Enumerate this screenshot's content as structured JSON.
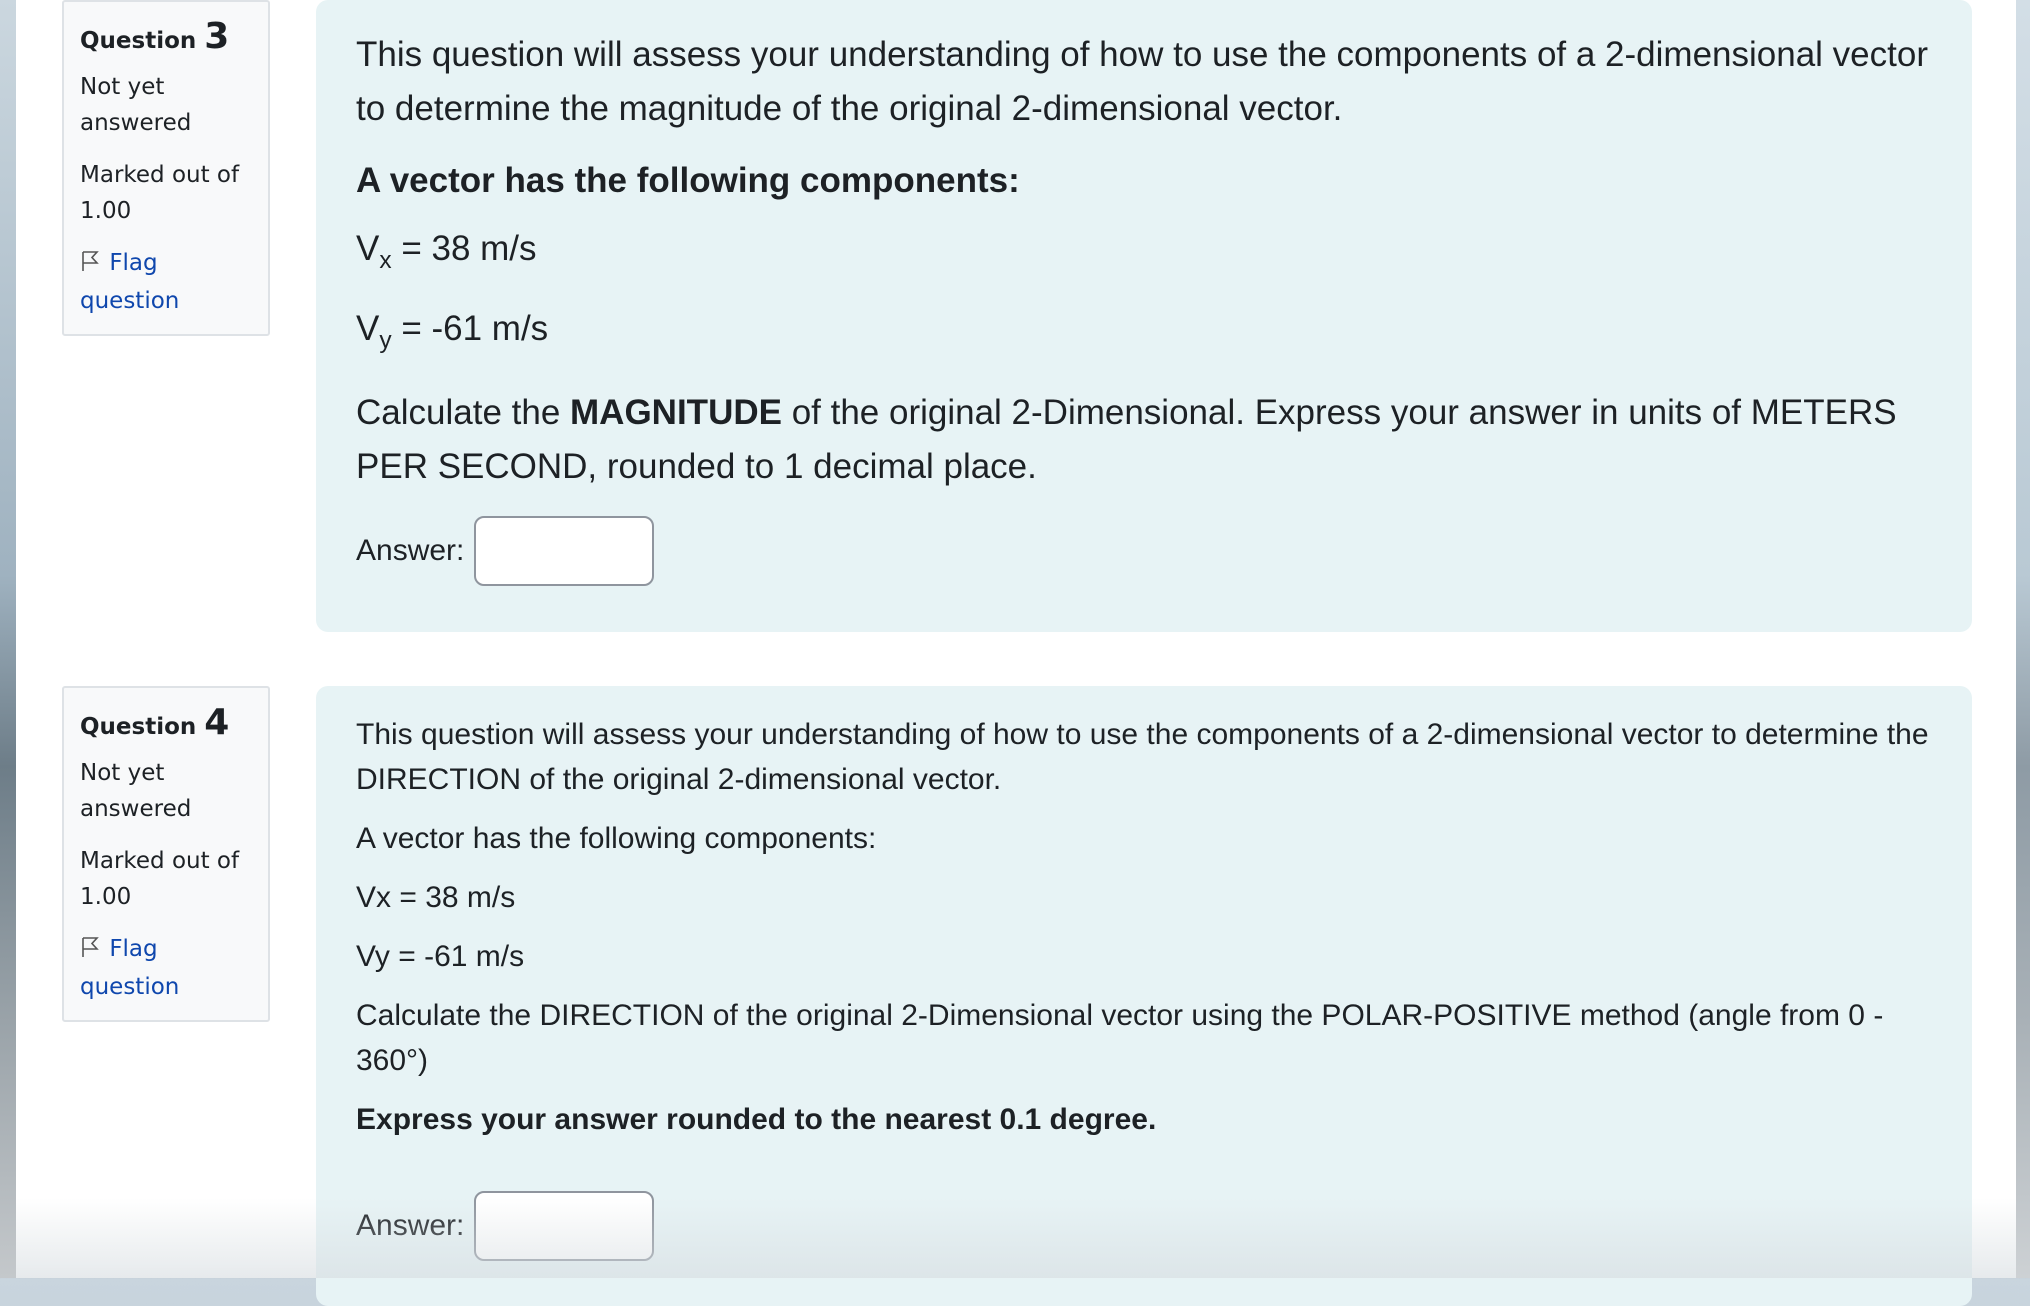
{
  "questions": [
    {
      "label": "Question",
      "number": "3",
      "state": "Not yet answered",
      "grade": "Marked out of 1.00",
      "flag_label": "Flag question",
      "intro": "This question will assess your understanding of how to use the components of a 2-dimensional vector to determine the magnitude of the original 2-dimensional vector.",
      "heading": "A vector has the following components:",
      "vx_symbol": "V",
      "vx_sub": "x",
      "vx_value": " = 38 m/s",
      "vy_symbol": "V",
      "vy_sub": "y",
      "vy_value": " = -61 m/s",
      "task_pre": "Calculate the ",
      "task_bold": "MAGNITUDE",
      "task_post": " of the original 2-Dimensional.  Express your answer in units of METERS PER SECOND, rounded to 1 decimal place.",
      "answer_label": "Answer:",
      "answer_value": ""
    },
    {
      "label": "Question",
      "number": "4",
      "state": "Not yet answered",
      "grade": "Marked out of 1.00",
      "flag_label": "Flag question",
      "intro": "This question will assess your understanding of how to use the components of a 2-dimensional vector to determine the DIRECTION of the original 2-dimensional vector.",
      "heading": "A vector has the following components:",
      "vx_line": "Vx = 38 m/s",
      "vy_line": "Vy = -61 m/s",
      "task": "Calculate the DIRECTION of the original 2-Dimensional vector using the POLAR-POSITIVE method (angle from 0 - 360°)",
      "instruction": "Express your answer rounded to the nearest 0.1 degree.",
      "answer_label": "Answer:",
      "answer_value": ""
    }
  ]
}
